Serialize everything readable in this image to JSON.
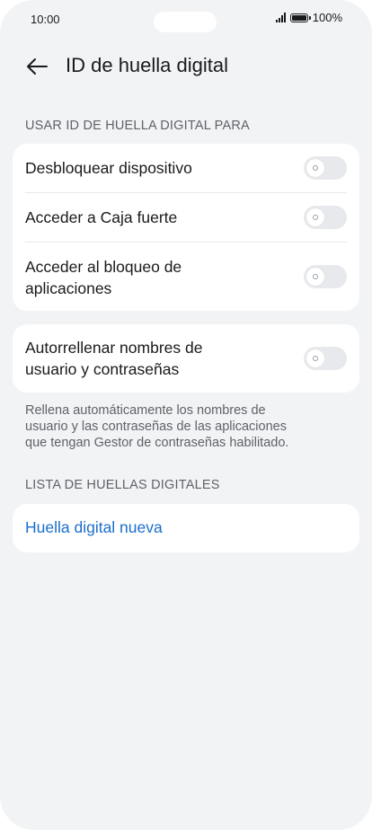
{
  "status_bar": {
    "time": "10:00",
    "battery": "100%",
    "icons": [
      "signal-icon",
      "battery-icon"
    ]
  },
  "header": {
    "back_icon": "arrow-left-icon",
    "title": "ID de huella digital"
  },
  "section_use": {
    "label": "USAR ID DE HUELLA DIGITAL PARA",
    "items": [
      {
        "label": "Desbloquear dispositivo",
        "enabled": false
      },
      {
        "label": "Acceder a Caja fuerte",
        "enabled": false
      },
      {
        "label_line1": "Acceder al bloqueo de",
        "label_line2": "aplicaciones",
        "enabled": false
      }
    ]
  },
  "autofill": {
    "label_line1": "Autorrellenar nombres de",
    "label_line2": "usuario y contraseñas",
    "enabled": false,
    "help_line1": "Rellena automáticamente los nombres de",
    "help_line2": "usuario y las contraseñas de las aplicaciones",
    "help_line3": "que tengan Gestor de contraseñas habilitado."
  },
  "section_list": {
    "label": "LISTA DE HUELLAS DIGITALES",
    "new_fingerprint": "Huella digital nueva"
  },
  "colors": {
    "background": "#f1f3f5",
    "card": "#ffffff",
    "link": "#1a6fcc",
    "toggle_off": "#e7e9ec"
  }
}
